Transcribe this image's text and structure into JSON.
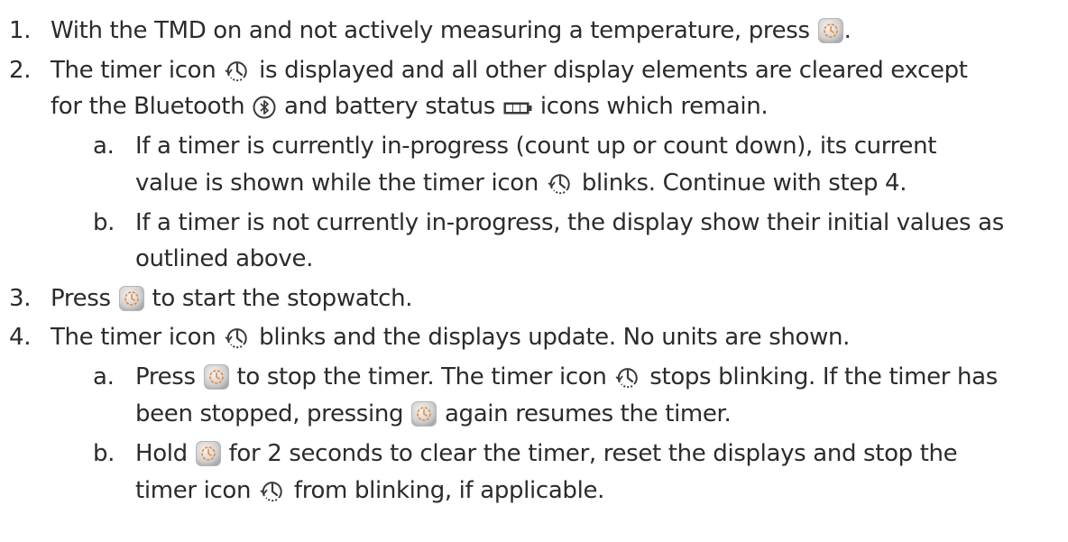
{
  "items": {
    "i1": {
      "num": "1.",
      "p1": "With the TMD on and not actively measuring a temperature, press ",
      "p2": "."
    },
    "i2": {
      "num": "2.",
      "l1a": "The timer icon ",
      "l1b": " is displayed and all other display elements are cleared except",
      "l2a": "for the Bluetooth ",
      "l2b": " and battery status ",
      "l2c": " icons which remain.",
      "a": {
        "num": "a.",
        "l1": "If a timer is currently in-progress (count up or count down), its current",
        "l2a": "value is shown while the timer icon ",
        "l2b": " blinks.  Continue with step 4."
      },
      "b": {
        "num": "b.",
        "l1": "If a timer is not currently in-progress, the display show their initial values as",
        "l2": "outlined above."
      }
    },
    "i3": {
      "num": "3.",
      "p1": "Press ",
      "p2": " to start the stopwatch."
    },
    "i4": {
      "num": "4.",
      "l1a": "The timer icon ",
      "l1b": " blinks and the displays update.  No units are shown.",
      "a": {
        "num": "a.",
        "l1a": "Press ",
        "l1b": " to stop the timer.  The timer icon ",
        "l1c": " stops blinking. If the timer has",
        "l2a": "been stopped, pressing ",
        "l2b": " again resumes the timer."
      },
      "b": {
        "num": "b.",
        "l1a": "Hold ",
        "l1b": " for 2 seconds to clear the timer, reset the displays and stop the",
        "l2a": "timer icon ",
        "l2b": " from blinking, if applicable."
      }
    }
  },
  "icons": {
    "timer_button": "timer-button-icon",
    "timer": "timer-icon",
    "bluetooth": "bluetooth-icon",
    "battery": "battery-icon"
  },
  "colors": {
    "text": "#2b2b2b",
    "button_face": "#d9d9d9",
    "button_accent": "#e8893a",
    "icon_stroke": "#3a3a3a"
  }
}
